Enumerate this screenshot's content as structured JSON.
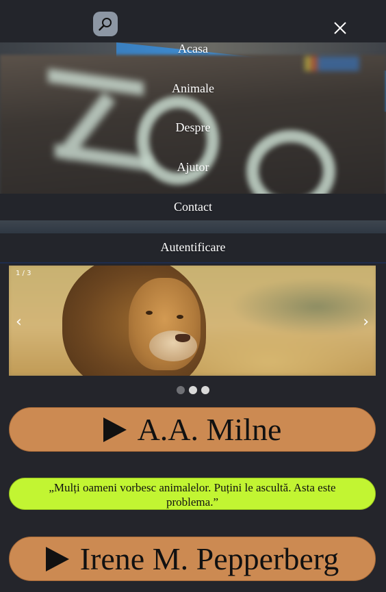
{
  "header": {
    "search_icon": "search-icon",
    "close_icon": "close-icon"
  },
  "menu": {
    "items": [
      {
        "label": "Acasa"
      },
      {
        "label": "Animale"
      },
      {
        "label": "Despre"
      },
      {
        "label": "Ajutor"
      },
      {
        "label": "Contact"
      },
      {
        "label": "Autentificare"
      }
    ]
  },
  "carousel": {
    "counter": "1 / 3",
    "prev_label": "‹",
    "next_label": "›",
    "slide_count": 3,
    "active_slide": 1
  },
  "authors": [
    {
      "name": "A.A. Milne"
    },
    {
      "name": "Irene M. Pepperberg"
    }
  ],
  "quote": {
    "text": "„Mulți oameni vorbesc animalelor. Puțini le ascultă. Asta este problema.”"
  },
  "colors": {
    "background": "#24252b",
    "author_button": "#cc8a52",
    "quote_box": "#c2f532"
  }
}
